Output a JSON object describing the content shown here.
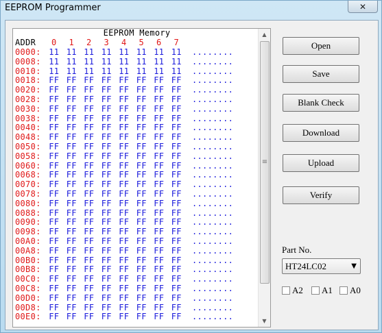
{
  "window": {
    "title": "EEPROM Programmer",
    "close_glyph": "✕"
  },
  "memory": {
    "title": "EEPROM Memory",
    "addr_header": "ADDR",
    "columns": [
      "0",
      "1",
      "2",
      "3",
      "4",
      "5",
      "6",
      "7"
    ],
    "rows": [
      {
        "addr": "0000:",
        "bytes": [
          "11",
          "11",
          "11",
          "11",
          "11",
          "11",
          "11",
          "11"
        ],
        "ascii": "........"
      },
      {
        "addr": "0008:",
        "bytes": [
          "11",
          "11",
          "11",
          "11",
          "11",
          "11",
          "11",
          "11"
        ],
        "ascii": "........"
      },
      {
        "addr": "0010:",
        "bytes": [
          "11",
          "11",
          "11",
          "11",
          "11",
          "11",
          "11",
          "11"
        ],
        "ascii": "........"
      },
      {
        "addr": "0018:",
        "bytes": [
          "FF",
          "FF",
          "FF",
          "FF",
          "FF",
          "FF",
          "FF",
          "FF"
        ],
        "ascii": "........"
      },
      {
        "addr": "0020:",
        "bytes": [
          "FF",
          "FF",
          "FF",
          "FF",
          "FF",
          "FF",
          "FF",
          "FF"
        ],
        "ascii": "........"
      },
      {
        "addr": "0028:",
        "bytes": [
          "FF",
          "FF",
          "FF",
          "FF",
          "FF",
          "FF",
          "FF",
          "FF"
        ],
        "ascii": "........"
      },
      {
        "addr": "0030:",
        "bytes": [
          "FF",
          "FF",
          "FF",
          "FF",
          "FF",
          "FF",
          "FF",
          "FF"
        ],
        "ascii": "........"
      },
      {
        "addr": "0038:",
        "bytes": [
          "FF",
          "FF",
          "FF",
          "FF",
          "FF",
          "FF",
          "FF",
          "FF"
        ],
        "ascii": "........"
      },
      {
        "addr": "0040:",
        "bytes": [
          "FF",
          "FF",
          "FF",
          "FF",
          "FF",
          "FF",
          "FF",
          "FF"
        ],
        "ascii": "........"
      },
      {
        "addr": "0048:",
        "bytes": [
          "FF",
          "FF",
          "FF",
          "FF",
          "FF",
          "FF",
          "FF",
          "FF"
        ],
        "ascii": "........"
      },
      {
        "addr": "0050:",
        "bytes": [
          "FF",
          "FF",
          "FF",
          "FF",
          "FF",
          "FF",
          "FF",
          "FF"
        ],
        "ascii": "........"
      },
      {
        "addr": "0058:",
        "bytes": [
          "FF",
          "FF",
          "FF",
          "FF",
          "FF",
          "FF",
          "FF",
          "FF"
        ],
        "ascii": "........"
      },
      {
        "addr": "0060:",
        "bytes": [
          "FF",
          "FF",
          "FF",
          "FF",
          "FF",
          "FF",
          "FF",
          "FF"
        ],
        "ascii": "........"
      },
      {
        "addr": "0068:",
        "bytes": [
          "FF",
          "FF",
          "FF",
          "FF",
          "FF",
          "FF",
          "FF",
          "FF"
        ],
        "ascii": "........"
      },
      {
        "addr": "0070:",
        "bytes": [
          "FF",
          "FF",
          "FF",
          "FF",
          "FF",
          "FF",
          "FF",
          "FF"
        ],
        "ascii": "........"
      },
      {
        "addr": "0078:",
        "bytes": [
          "FF",
          "FF",
          "FF",
          "FF",
          "FF",
          "FF",
          "FF",
          "FF"
        ],
        "ascii": "........"
      },
      {
        "addr": "0080:",
        "bytes": [
          "FF",
          "FF",
          "FF",
          "FF",
          "FF",
          "FF",
          "FF",
          "FF"
        ],
        "ascii": "........"
      },
      {
        "addr": "0088:",
        "bytes": [
          "FF",
          "FF",
          "FF",
          "FF",
          "FF",
          "FF",
          "FF",
          "FF"
        ],
        "ascii": "........"
      },
      {
        "addr": "0090:",
        "bytes": [
          "FF",
          "FF",
          "FF",
          "FF",
          "FF",
          "FF",
          "FF",
          "FF"
        ],
        "ascii": "........"
      },
      {
        "addr": "0098:",
        "bytes": [
          "FF",
          "FF",
          "FF",
          "FF",
          "FF",
          "FF",
          "FF",
          "FF"
        ],
        "ascii": "........"
      },
      {
        "addr": "00A0:",
        "bytes": [
          "FF",
          "FF",
          "FF",
          "FF",
          "FF",
          "FF",
          "FF",
          "FF"
        ],
        "ascii": "........"
      },
      {
        "addr": "00A8:",
        "bytes": [
          "FF",
          "FF",
          "FF",
          "FF",
          "FF",
          "FF",
          "FF",
          "FF"
        ],
        "ascii": "........"
      },
      {
        "addr": "00B0:",
        "bytes": [
          "FF",
          "FF",
          "FF",
          "FF",
          "FF",
          "FF",
          "FF",
          "FF"
        ],
        "ascii": "........"
      },
      {
        "addr": "00B8:",
        "bytes": [
          "FF",
          "FF",
          "FF",
          "FF",
          "FF",
          "FF",
          "FF",
          "FF"
        ],
        "ascii": "........"
      },
      {
        "addr": "00C0:",
        "bytes": [
          "FF",
          "FF",
          "FF",
          "FF",
          "FF",
          "FF",
          "FF",
          "FF"
        ],
        "ascii": "........"
      },
      {
        "addr": "00C8:",
        "bytes": [
          "FF",
          "FF",
          "FF",
          "FF",
          "FF",
          "FF",
          "FF",
          "FF"
        ],
        "ascii": "........"
      },
      {
        "addr": "00D0:",
        "bytes": [
          "FF",
          "FF",
          "FF",
          "FF",
          "FF",
          "FF",
          "FF",
          "FF"
        ],
        "ascii": "........"
      },
      {
        "addr": "00D8:",
        "bytes": [
          "FF",
          "FF",
          "FF",
          "FF",
          "FF",
          "FF",
          "FF",
          "FF"
        ],
        "ascii": "........"
      },
      {
        "addr": "00E0:",
        "bytes": [
          "FF",
          "FF",
          "FF",
          "FF",
          "FF",
          "FF",
          "FF",
          "FF"
        ],
        "ascii": "........"
      }
    ]
  },
  "buttons": {
    "open": "Open",
    "save": "Save",
    "blank_check": "Blank Check",
    "download": "Download",
    "upload": "Upload",
    "verify": "Verify"
  },
  "part": {
    "label": "Part No.",
    "selected": "HT24LC02",
    "arrow_glyph": "▼"
  },
  "address_pins": [
    {
      "label": "A2",
      "checked": false
    },
    {
      "label": "A1",
      "checked": false
    },
    {
      "label": "A0",
      "checked": false
    }
  ],
  "scrollbar": {
    "up_glyph": "▲",
    "down_glyph": "▼",
    "grip_glyph": "≡"
  },
  "colors": {
    "address": "#e01818",
    "column_header": "#e01818",
    "byte_value": "#1a1adc",
    "title_bar": "#cfe7f5"
  }
}
